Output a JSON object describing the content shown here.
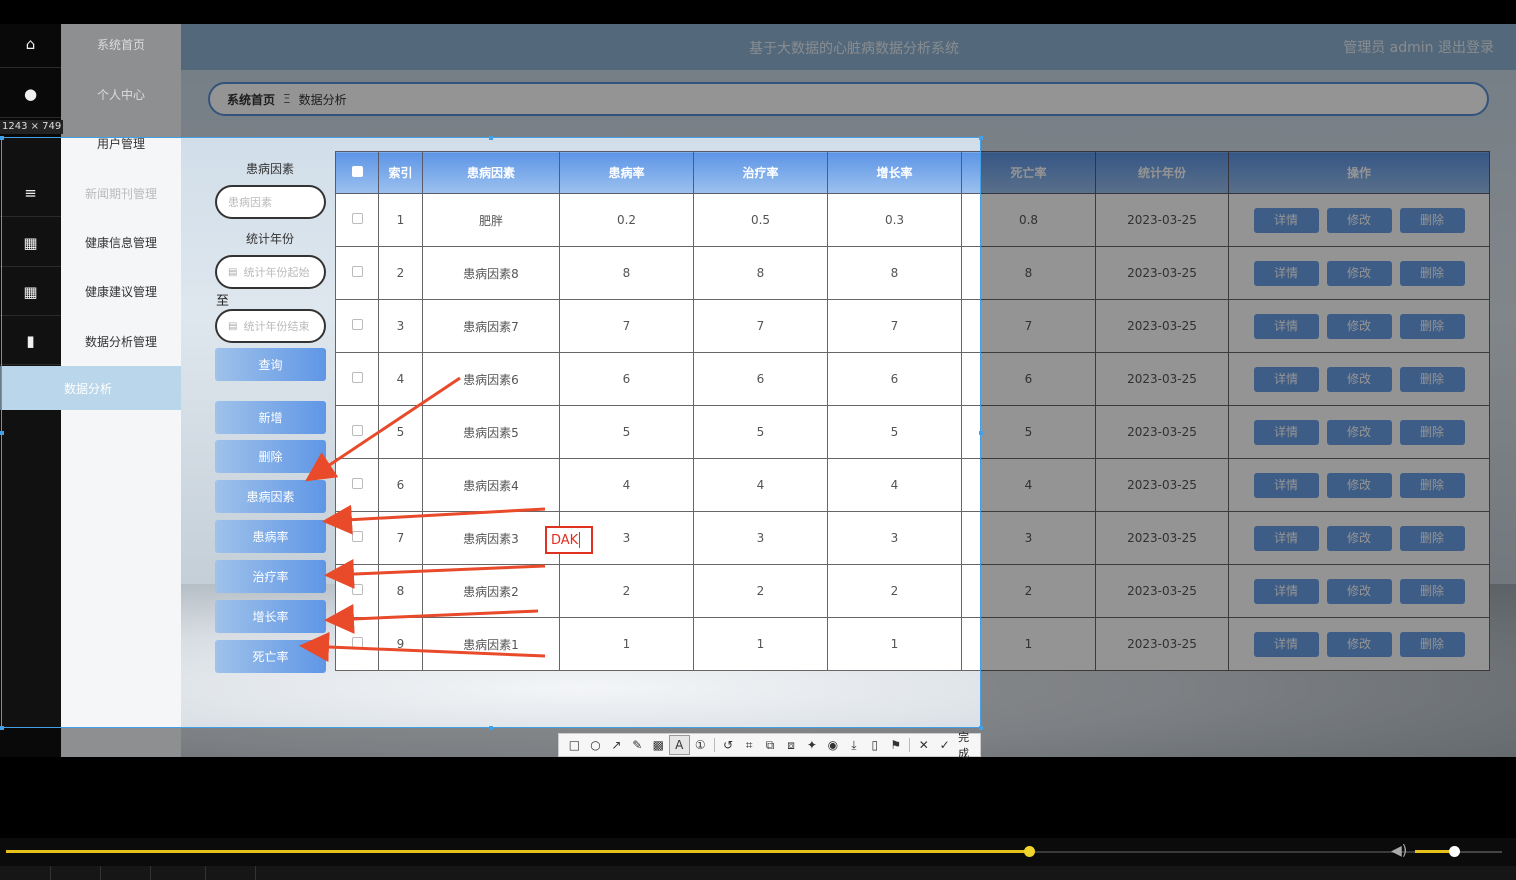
{
  "app": {
    "title": "基于大数据的心脏病数据分析系统",
    "admin_info": "管理员 admin  退出登录"
  },
  "menu": {
    "items": [
      {
        "label": "系统首页",
        "icon": "home-icon"
      },
      {
        "label": "个人中心",
        "icon": "user-icon"
      },
      {
        "label": "用户管理",
        "icon": "grid-icon"
      },
      {
        "label": "新闻期刊管理",
        "icon": "list-icon"
      },
      {
        "label": "健康信息管理",
        "icon": "grid-icon"
      },
      {
        "label": "健康建议管理",
        "icon": "grid-icon"
      },
      {
        "label": "数据分析管理",
        "icon": "book-icon"
      }
    ],
    "active_sub": "数据分析"
  },
  "breadcrumb": {
    "home": "系统首页",
    "separator": "Ξ",
    "current": "数据分析"
  },
  "filters": {
    "factor_label": "患病因素",
    "factor_placeholder": "患病因素",
    "year_label": "统计年份",
    "year_start_placeholder": "统计年份起始",
    "to_label": "至",
    "year_end_placeholder": "统计年份结束",
    "query_button": "查询"
  },
  "actions": {
    "add": "新增",
    "delete": "删除",
    "chart_buttons": [
      "患病因素",
      "患病率",
      "治疗率",
      "增长率",
      "死亡率"
    ]
  },
  "table": {
    "headers": [
      "索引",
      "患病因素",
      "患病率",
      "治疗率",
      "增长率",
      "死亡率",
      "统计年份",
      "操作"
    ],
    "rows": [
      [
        "1",
        "肥胖",
        "0.2",
        "0.5",
        "0.3",
        "0.8",
        "2023-03-25"
      ],
      [
        "2",
        "患病因素8",
        "8",
        "8",
        "8",
        "8",
        "2023-03-25"
      ],
      [
        "3",
        "患病因素7",
        "7",
        "7",
        "7",
        "7",
        "2023-03-25"
      ],
      [
        "4",
        "患病因素6",
        "6",
        "6",
        "6",
        "6",
        "2023-03-25"
      ],
      [
        "5",
        "患病因素5",
        "5",
        "5",
        "5",
        "5",
        "2023-03-25"
      ],
      [
        "6",
        "患病因素4",
        "4",
        "4",
        "4",
        "4",
        "2023-03-25"
      ],
      [
        "7",
        "患病因素3",
        "3",
        "3",
        "3",
        "3",
        "2023-03-25"
      ],
      [
        "8",
        "患病因素2",
        "2",
        "2",
        "2",
        "2",
        "2023-03-25"
      ],
      [
        "9",
        "患病因素1",
        "1",
        "1",
        "1",
        "1",
        "2023-03-25"
      ]
    ],
    "row_buttons": [
      "详情",
      "修改",
      "删除"
    ]
  },
  "capture": {
    "size_label": "1243 × 749",
    "annotation_text": "DAK",
    "annotation_color": "#e03020",
    "arrow_color": "#e84a2a",
    "done_label": "完成",
    "tools": [
      "rect-tool-icon",
      "ellipse-tool-icon",
      "arrow-tool-icon",
      "pen-tool-icon",
      "mosaic-tool-icon",
      "text-tool-icon",
      "number-tool-icon",
      "undo-icon",
      "crop-icon",
      "ocr-icon",
      "translate-icon",
      "pin-icon",
      "record-icon",
      "save-icon",
      "copy-icon",
      "bookmark-icon",
      "close-icon",
      "check-icon"
    ]
  },
  "player": {
    "progress": 0.684,
    "volume": 0.45
  }
}
